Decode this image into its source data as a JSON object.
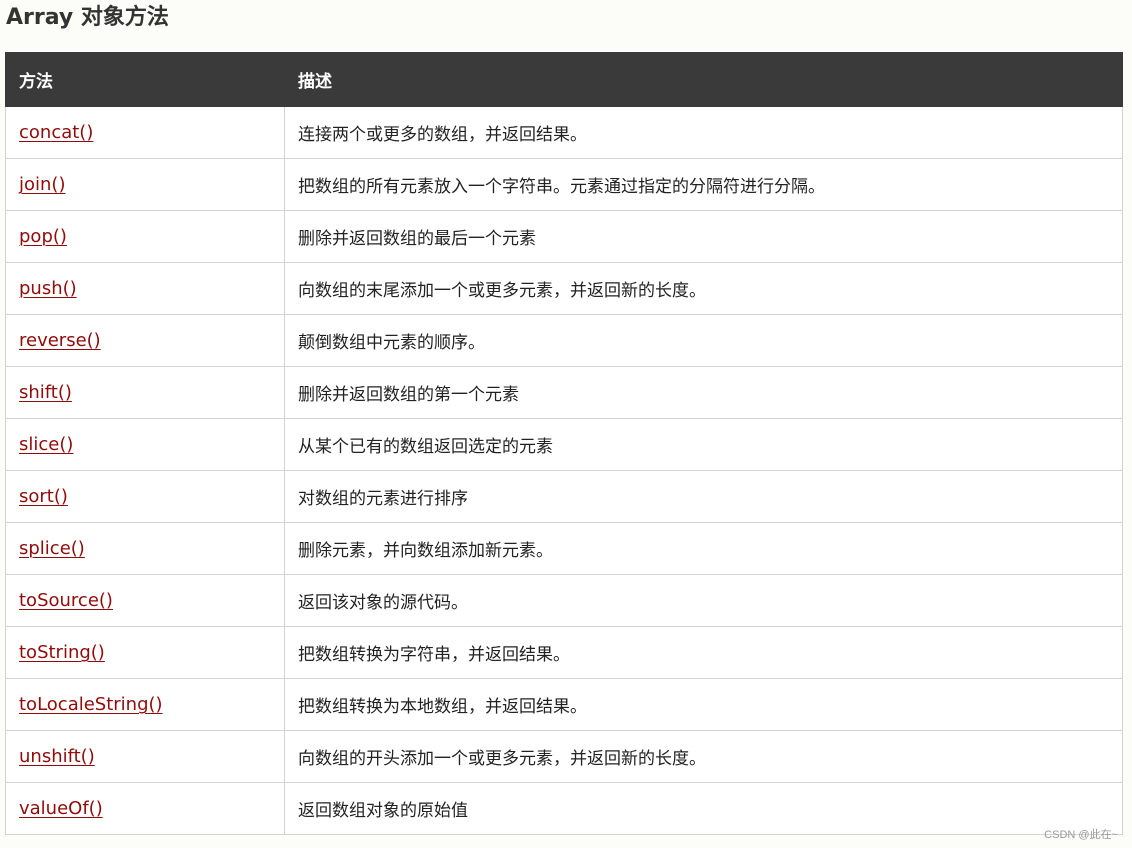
{
  "title": "Array 对象方法",
  "table": {
    "headers": [
      "方法",
      "描述"
    ],
    "rows": [
      {
        "method": "concat()",
        "description": "连接两个或更多的数组，并返回结果。"
      },
      {
        "method": "join()",
        "description": "把数组的所有元素放入一个字符串。元素通过指定的分隔符进行分隔。"
      },
      {
        "method": "pop()",
        "description": "删除并返回数组的最后一个元素"
      },
      {
        "method": "push()",
        "description": "向数组的末尾添加一个或更多元素，并返回新的长度。"
      },
      {
        "method": "reverse()",
        "description": "颠倒数组中元素的顺序。"
      },
      {
        "method": "shift()",
        "description": "删除并返回数组的第一个元素"
      },
      {
        "method": "slice()",
        "description": "从某个已有的数组返回选定的元素"
      },
      {
        "method": "sort()",
        "description": "对数组的元素进行排序"
      },
      {
        "method": "splice()",
        "description": "删除元素，并向数组添加新元素。"
      },
      {
        "method": "toSource()",
        "description": "返回该对象的源代码。"
      },
      {
        "method": "toString()",
        "description": "把数组转换为字符串，并返回结果。"
      },
      {
        "method": "toLocaleString()",
        "description": "把数组转换为本地数组，并返回结果。"
      },
      {
        "method": "unshift()",
        "description": "向数组的开头添加一个或更多元素，并返回新的长度。"
      },
      {
        "method": "valueOf()",
        "description": "返回数组对象的原始值"
      }
    ]
  },
  "watermark": "CSDN @此在~",
  "colors": {
    "header_bg": "#3a3a3a",
    "link": "#900b09",
    "border": "#d4d4d4"
  }
}
